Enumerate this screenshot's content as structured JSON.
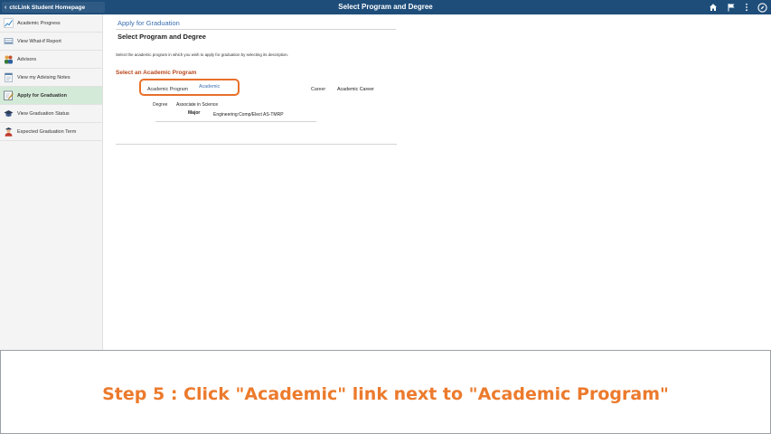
{
  "topbar": {
    "back_label": "ctcLink Student Homepage",
    "title": "Select Program and Degree",
    "icons": [
      "home-icon",
      "flag-icon",
      "more-vertical-icon",
      "navbar-compass-icon"
    ]
  },
  "sidebar": {
    "items": [
      {
        "label": "Academic Progress",
        "icon": "chart-line-icon"
      },
      {
        "label": "View What-if Report",
        "icon": "report-icon"
      },
      {
        "label": "Advisors",
        "icon": "people-icon"
      },
      {
        "label": "View my Advising Notes",
        "icon": "notes-icon"
      },
      {
        "label": "Apply for Graduation",
        "icon": "edit-form-icon",
        "active": true
      },
      {
        "label": "View Graduation Status",
        "icon": "graduation-cap-icon"
      },
      {
        "label": "Expected Graduation Term",
        "icon": "graduate-person-icon"
      }
    ]
  },
  "main": {
    "breadcrumb": "Apply for Graduation",
    "page_title": "Select Program and Degree",
    "instruction": "Select the academic program in which you wish to apply for graduation by selecting its description.",
    "section_title": "Select an Academic Program",
    "program_label": "Academic Program",
    "program_link": "Academic",
    "career_label": "Career",
    "career_value": "Academic Career",
    "degree_label": "Degree",
    "degree_value": "Associate in Science",
    "major_label": "Major",
    "major_value": "Engineering:Comp/Elect AS-TMRP"
  },
  "step": {
    "text": "Step 5 : Click \"Academic\" link next to \"Academic Program\""
  },
  "colors": {
    "topbar": "#1e4d7a",
    "active_nav": "#d4ead8",
    "link": "#3a6fb0",
    "section_title": "#b8471a",
    "highlight": "#e8702a",
    "step_text": "#ec7a2c"
  }
}
